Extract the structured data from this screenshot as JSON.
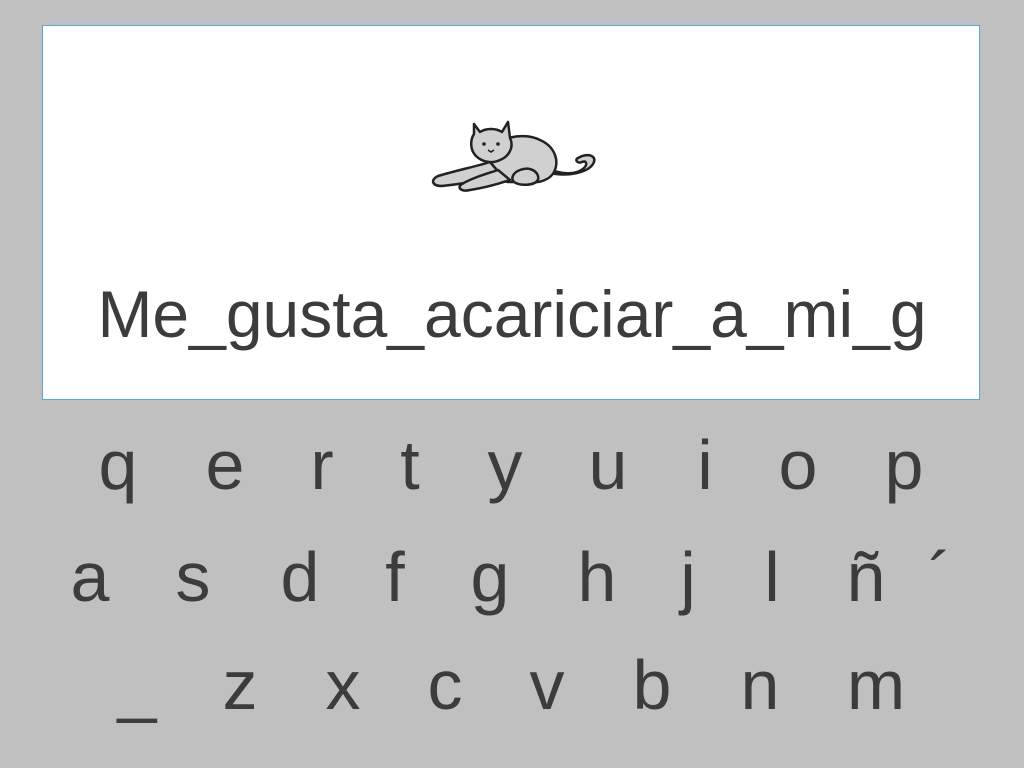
{
  "display": {
    "sentence": "Me_gusta_acariciar_a_mi_g",
    "pictogram_icon": "cat-lying-icon"
  },
  "keyboard": {
    "row1": [
      "q",
      "e",
      "r",
      "t",
      "y",
      "u",
      "i",
      "o",
      "p"
    ],
    "row2": [
      "a",
      "s",
      "d",
      "f",
      "g",
      "h",
      "j",
      "l",
      "ñ",
      "´"
    ],
    "row3": [
      "_",
      "z",
      "x",
      "c",
      "v",
      "b",
      "n",
      "m"
    ]
  },
  "colors": {
    "background": "#c0c0c0",
    "card": "#ffffff",
    "card_border": "#5ba7d6",
    "text": "#3c3c3c"
  }
}
